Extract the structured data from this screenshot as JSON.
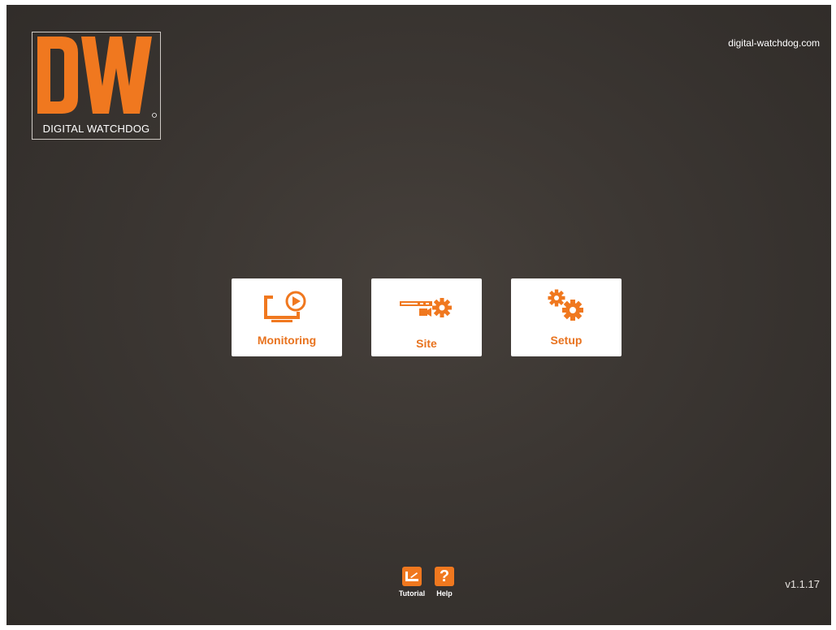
{
  "brand": {
    "logo_text": "DIGITAL WATCHDOG",
    "site_url": "digital-watchdog.com",
    "accent_color": "#F0781F"
  },
  "main_menu": {
    "tiles": [
      {
        "label": "Monitoring",
        "icon": "monitor-play-icon"
      },
      {
        "label": "Site",
        "icon": "site-gear-icon"
      },
      {
        "label": "Setup",
        "icon": "gears-icon"
      }
    ]
  },
  "footer": {
    "tutorial_label": "Tutorial",
    "tutorial_icon": "tutorial-icon",
    "help_label": "Help",
    "help_icon": "help-question-icon",
    "help_glyph": "?",
    "version": "v1.1.17"
  }
}
